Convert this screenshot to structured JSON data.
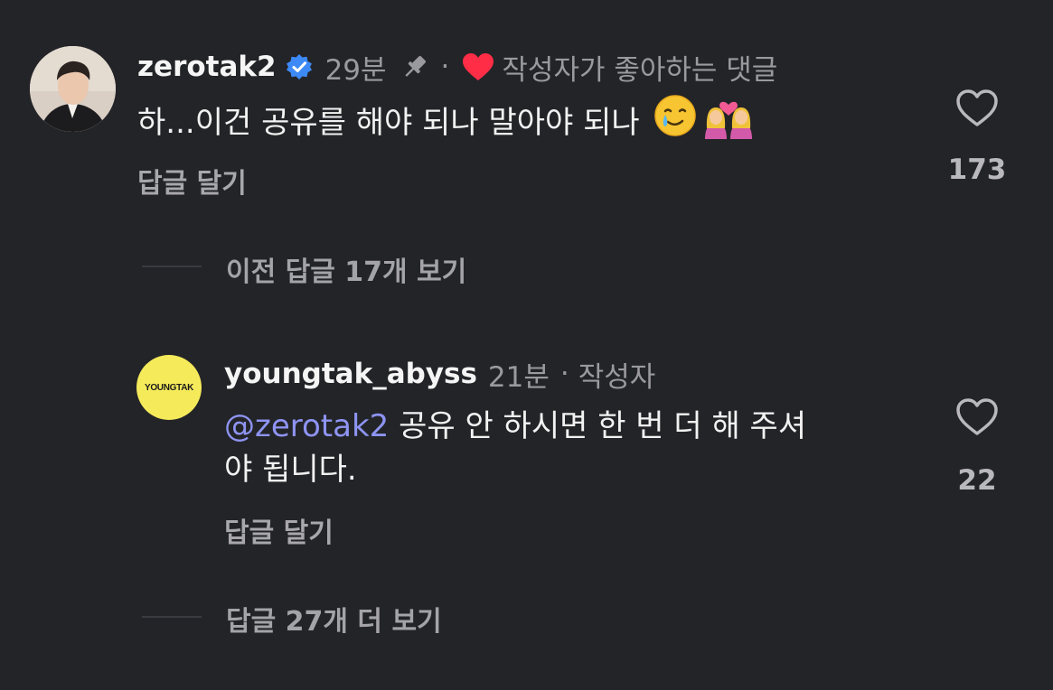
{
  "comment": {
    "username": "zerotak2",
    "time": "29분",
    "dot": "·",
    "liked_by_creator": "작성자가 좋아하는 댓글",
    "text": "하...이건 공유를 해야 되나 말아야 되나",
    "reply_label": "답글 달기",
    "like_count": "173"
  },
  "previous_replies": "이전 답글 17개 보기",
  "reply": {
    "username": "youngtak_abyss",
    "time": "21분",
    "dot": "·",
    "role": "작성자",
    "avatar_text": "YOUNGTAK",
    "mention": "@zerotak2",
    "text_line1": " 공유 안 하시면 한 번 더 해 주셔",
    "text_line2": "야 됩니다.",
    "reply_label": "답글 달기",
    "like_count": "22"
  },
  "more_replies": "답글 27개 더 보기",
  "colors": {
    "background": "#232428",
    "mention": "#8e94f2",
    "verified": "#3d8af7",
    "heart": "#ff2d46",
    "avatar_yellow": "#f5ea5a"
  }
}
